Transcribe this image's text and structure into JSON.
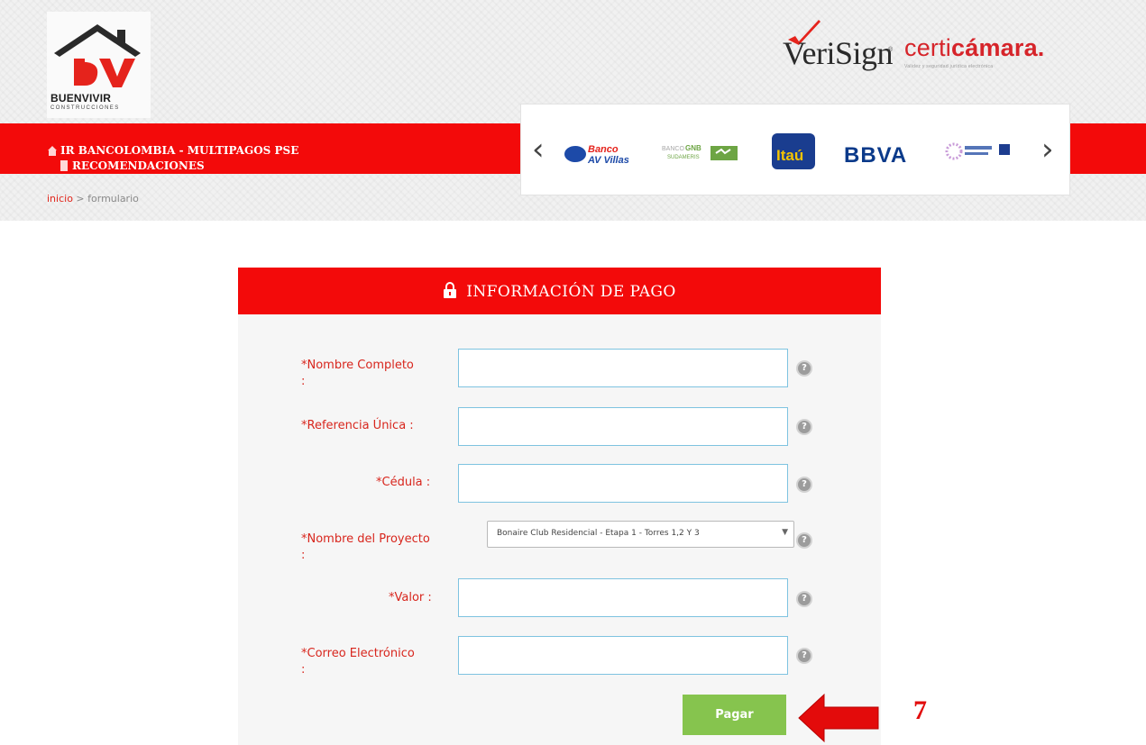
{
  "brand": {
    "name": "BUENVIVIR",
    "subtitle": "CONSTRUCCIONES",
    "verisign": "VeriSign",
    "certicamara_a": "certi",
    "certicamara_b": "cámara.",
    "certicamara_tagline": "Validez y seguridad jurídica electrónica"
  },
  "nav": {
    "link1": "IR BANCOLOMBIA - MULTIPAGOS PSE",
    "link2": "RECOMENDACIONES"
  },
  "carousel": {
    "banks": [
      "Banco AV Villas",
      "Banco GNB Sudameris",
      "Itaú",
      "BBVA",
      "Banco Caja Social"
    ],
    "prev_icon": "chevron-left-icon",
    "next_icon": "chevron-right-icon"
  },
  "breadcrumb": {
    "home": "inicio",
    "separator": ">",
    "current": "formulario"
  },
  "form": {
    "title": "INFORMACIÓN DE PAGO",
    "fields": [
      {
        "label": "*Nombre Completo",
        "label_suffix": ":",
        "value": ""
      },
      {
        "label": "*Referencia Única :",
        "value": ""
      },
      {
        "label": "*Cédula :",
        "value": ""
      },
      {
        "label": "*Nombre del Proyecto",
        "label_suffix": ":",
        "selected": "Bonaire Club Residencial - Etapa 1 - Torres 1,2 Y 3"
      },
      {
        "label": "*Valor :",
        "value": ""
      },
      {
        "label": "*Correo Electrónico",
        "label_suffix": ":",
        "value": ""
      }
    ],
    "submit_label": "Pagar"
  },
  "annotation": {
    "step_number": "7"
  },
  "colors": {
    "brand_red": "#f30a0a",
    "label_red": "#d8261d",
    "pay_green": "#86c44e",
    "field_border": "#7ec3e0"
  }
}
